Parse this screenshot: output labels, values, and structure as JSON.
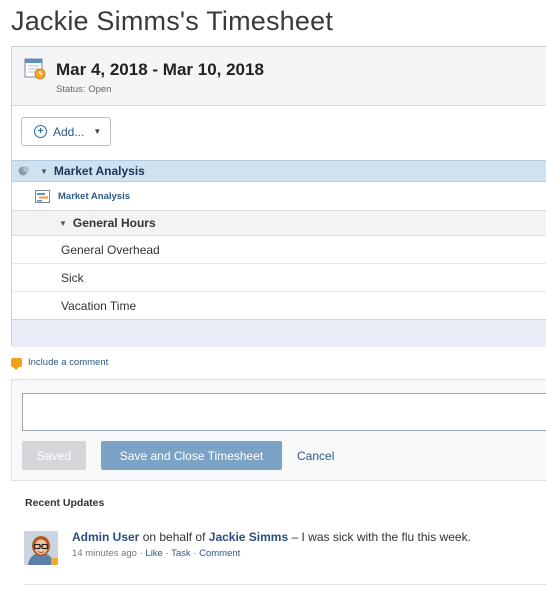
{
  "page": {
    "title": "Jackie Simms's Timesheet"
  },
  "header": {
    "date_range": "Mar 4, 2018 - Mar 10, 2018",
    "status": "Status: Open"
  },
  "toolbar": {
    "add_label": "Add..."
  },
  "project": {
    "label": "Market Analysis"
  },
  "task": {
    "label": "Market Analysis"
  },
  "group": {
    "label": "General Hours"
  },
  "items": [
    {
      "label": "General Overhead"
    },
    {
      "label": "Sick"
    },
    {
      "label": "Vacation Time"
    }
  ],
  "comment": {
    "link_label": "Include a comment",
    "value": ""
  },
  "actions": {
    "saved_label": "Saved",
    "save_close_label": "Save and Close Timesheet",
    "cancel_label": "Cancel"
  },
  "recent": {
    "title": "Recent Updates",
    "updates": [
      {
        "author": "Admin User",
        "behalf_text": "on behalf of",
        "subject": "Jackie Simms",
        "message": "– I was sick with the flu this week.",
        "time": "14 minutes ago ·",
        "like": "Like",
        "sep": "·",
        "task": "Task",
        "comment": "Comment"
      }
    ]
  },
  "colors": {
    "accent": "#2a5a8c",
    "project_row": "#cfe2f1",
    "save_button": "#7aa3c6",
    "saved_button": "#d4d6d9",
    "comment_icon": "#f0a018"
  }
}
